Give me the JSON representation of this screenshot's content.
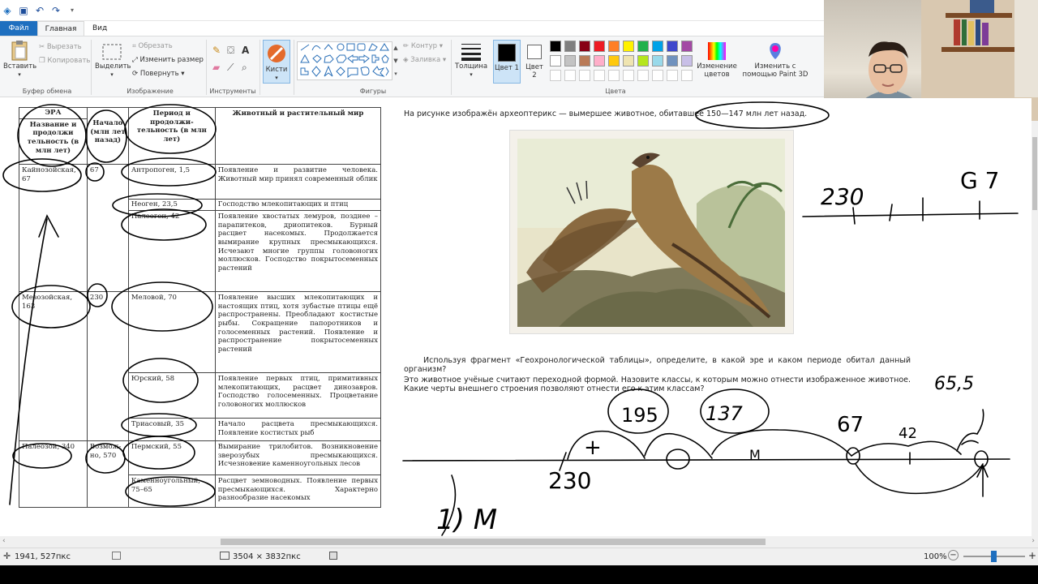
{
  "quick_access": {
    "save_icon": "save-icon",
    "undo_icon": "undo-icon",
    "redo_icon": "redo-icon"
  },
  "tabs": {
    "file": "Файл",
    "home": "Главная",
    "view": "Вид"
  },
  "ribbon": {
    "clipboard": {
      "paste": "Вставить",
      "cut": "Вырезать",
      "copy": "Копировать",
      "label": "Буфер обмена"
    },
    "image": {
      "select": "Выделить",
      "crop": "Обрезать",
      "resize": "Изменить размер",
      "rotate": "Повернуть",
      "label": "Изображение"
    },
    "tools": {
      "label": "Инструменты"
    },
    "brushes": {
      "label": "Кисти"
    },
    "shapes": {
      "outline": "Контур",
      "fill": "Заливка",
      "label": "Фигуры"
    },
    "size": {
      "label": "Толщина"
    },
    "colors": {
      "color1": "Цвет 1",
      "color2": "Цвет 2",
      "edit": "Изменение цветов",
      "paint3d": "Изменить с помощью Paint 3D",
      "label": "Цвета",
      "palette": [
        "#000000",
        "#7f7f7f",
        "#880015",
        "#ed1c24",
        "#ff7f27",
        "#fff200",
        "#22b14c",
        "#00a2e8",
        "#3f48cc",
        "#a349a4",
        "#ffffff",
        "#c3c3c3",
        "#b97a57",
        "#ffaec9",
        "#ffc90e",
        "#efe4b0",
        "#b5e61d",
        "#99d9ea",
        "#7092be",
        "#c8bfe7"
      ]
    }
  },
  "table": {
    "h_era": "ЭРА",
    "h_era_name": "Название и продолжи тельность (в млн лет)",
    "h_start": "Начало (млн лет назад)",
    "h_period": "Период и продолжи-тельность (в млн лет)",
    "h_life": "Животный и растительный мир",
    "rows": [
      {
        "era": "Кайнозойская, 67",
        "start": "67",
        "period": "Антропоген, 1,5",
        "life": "Появление и развитие человека. Животный мир принял современный облик"
      },
      {
        "period": "Неоген, 23,5",
        "life": "Господство млекопитающих и птиц"
      },
      {
        "period": "Палеоген, 42",
        "life": "Появление хвостатых лемуров, позднее – парапитеков, дриопитеков. Бурный расцвет насекомых. Продолжается вымирание крупных пресмыкающихся. Исчезают многие группы головоногих моллюсков. Господство покрытосеменных растений"
      },
      {
        "era": "Мезозойская, 163",
        "start": "230",
        "period": "Меловой, 70",
        "life": "Появление высших млекопитающих и настоящих птиц, хотя зубастые птицы ещё распространены. Преобладают костистые рыбы. Сокращение папоротников и голосеменных растений. Появление и распространение покрытосеменных растений"
      },
      {
        "period": "Юрский, 58",
        "life": "Появление первых птиц, примитивных млекопитающих, расцвет динозавров. Господство голосеменных. Процветание головоногих моллюсков"
      },
      {
        "period": "Триасовый, 35",
        "life": "Начало расцвета пресмыкающихся. Появление костистых рыб"
      },
      {
        "era": "Палеозой, 340",
        "start": "Возмож-но, 570",
        "period": "Пермский, 55",
        "life": "Вымирание трилобитов. Возникновение зверозубых пресмыкающихся. Исчезновение каменноугольных лесов"
      },
      {
        "period": "Каменноугольный, 75–65",
        "life": "Расцвет земноводных. Появление первых пресмыкающихся. Характерно разнообразие насекомых"
      }
    ]
  },
  "task": {
    "intro": "На рисунке изображён археоптерикс — вымершее животное, обитавшее 150—147 млн лет назад.",
    "q1": "Используя фрагмент «Геохронологической таблицы», определите, в какой эре и каком периоде обитал данный организм?",
    "q2": "Это животное учёные считают переходной формой. Назовите классы, к которым можно отнести изображенное животное. Какие черты внешнего строения позволяют отнести его к этим классам?"
  },
  "handwriting": {
    "n230a": "230",
    "n67a": "G 7",
    "n65": "65,5",
    "n195": "195",
    "n137": "137",
    "n67b": "67",
    "n42": "42",
    "plus": "+",
    "n230b": "230",
    "m": "M",
    "answer": "1) M"
  },
  "status": {
    "cursor_pos": "1941, 527пкс",
    "canvas_size": "3504 × 3832пкс",
    "zoom": "100%"
  }
}
